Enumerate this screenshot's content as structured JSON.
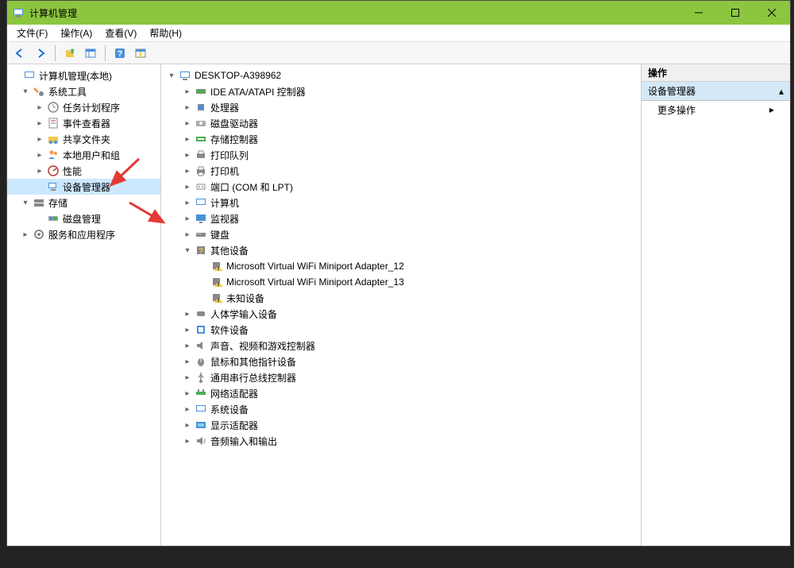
{
  "window": {
    "title": "计算机管理"
  },
  "menubar": {
    "file": "文件(F)",
    "action": "操作(A)",
    "view": "查看(V)",
    "help": "帮助(H)"
  },
  "leftTree": {
    "root": "计算机管理(本地)",
    "sysTools": "系统工具",
    "taskScheduler": "任务计划程序",
    "eventViewer": "事件查看器",
    "sharedFolders": "共享文件夹",
    "localUsers": "本地用户和组",
    "performance": "性能",
    "deviceManager": "设备管理器",
    "storage": "存储",
    "diskMgmt": "磁盘管理",
    "services": "服务和应用程序"
  },
  "midTree": {
    "root": "DESKTOP-A398962",
    "ide": "IDE ATA/ATAPI 控制器",
    "processor": "处理器",
    "diskDrive": "磁盘驱动器",
    "storageCtrl": "存储控制器",
    "printQueue": "打印队列",
    "printer": "打印机",
    "ports": "端口 (COM 和 LPT)",
    "computer": "计算机",
    "monitor": "监视器",
    "keyboard": "键盘",
    "otherDevices": "其他设备",
    "wifi12": "Microsoft Virtual WiFi Miniport Adapter_12",
    "wifi13": "Microsoft Virtual WiFi Miniport Adapter_13",
    "unknown": "未知设备",
    "hid": "人体学输入设备",
    "software": "软件设备",
    "sound": "声音、视频和游戏控制器",
    "mouse": "鼠标和其他指针设备",
    "usb": "通用串行总线控制器",
    "network": "网络适配器",
    "system": "系统设备",
    "display": "显示适配器",
    "audio": "音频输入和输出"
  },
  "rightPanel": {
    "header": "操作",
    "section": "设备管理器",
    "moreActions": "更多操作"
  }
}
